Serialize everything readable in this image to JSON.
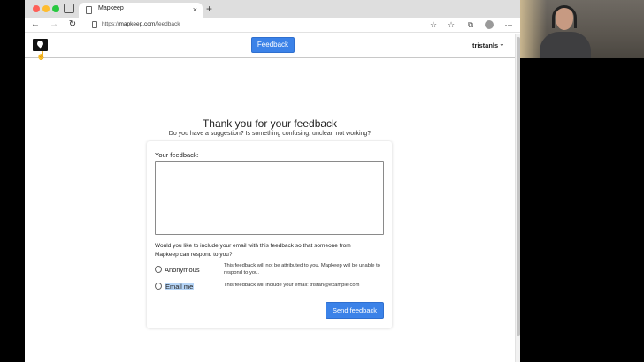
{
  "browser": {
    "tab_title": "Mapkeep",
    "tab_close": "×",
    "new_tab": "+",
    "url_prefix": "https://",
    "url_host": "mapkeep.com",
    "url_path": "/feedback",
    "back": "←",
    "forward": "→",
    "reload": "↻",
    "more": "⋯"
  },
  "header": {
    "feedback_button": "Feedback",
    "username": "tristanls",
    "user_chevron": "⌄"
  },
  "main": {
    "title": "Thank you for your feedback",
    "subtitle": "Do you have a suggestion? Is something confusing, unclear, not working?"
  },
  "form": {
    "feedback_label": "Your feedback:",
    "feedback_value": "",
    "email_question": "Would you like to include your email with this feedback so that someone from Mapkeep can respond to you?",
    "options": [
      {
        "label": "Anonymous",
        "description": "This feedback will not be attributed to you. Mapkeep will be unable to respond to you.",
        "selected": false
      },
      {
        "label": "Email me",
        "description": "This feedback will include your email: tristan@example.com",
        "selected": false
      }
    ],
    "submit_label": "Send feedback"
  },
  "colors": {
    "accent": "#3b82e8",
    "selection_highlight": "#b6d5f7"
  }
}
